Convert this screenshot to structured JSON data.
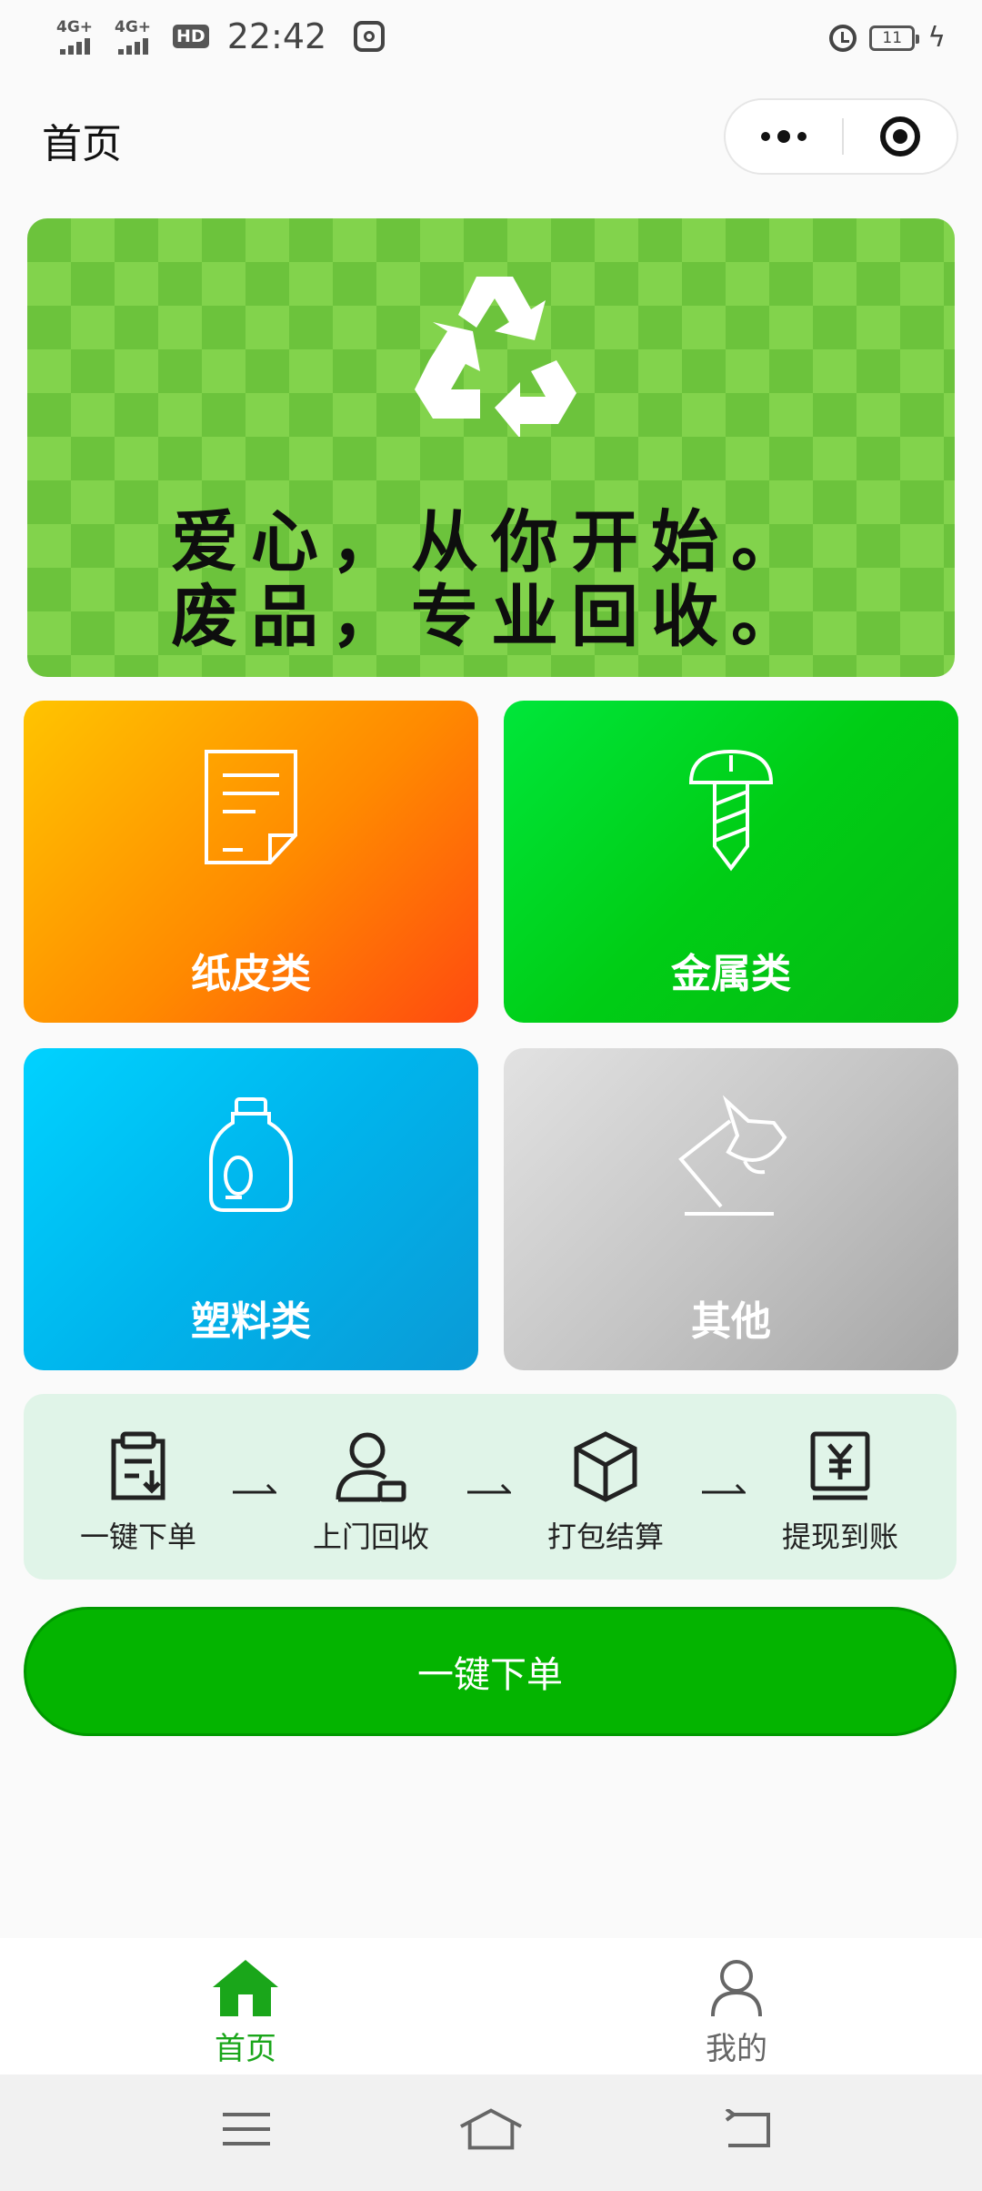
{
  "status_bar": {
    "network_1": "4G+",
    "network_2": "4G+",
    "hd_label": "HD",
    "time": "22:42",
    "battery_level": "11"
  },
  "header": {
    "title": "首页"
  },
  "banner": {
    "line1": "爱心，从你开始。",
    "line2": "废品，专业回收。",
    "icon": "recycle-icon"
  },
  "categories": [
    {
      "label": "纸皮类",
      "icon": "paper-document-icon",
      "colors": [
        "#ffc400",
        "#ff4a10"
      ]
    },
    {
      "label": "金属类",
      "icon": "screw-icon",
      "colors": [
        "#00e63a",
        "#06b913"
      ]
    },
    {
      "label": "塑料类",
      "icon": "plastic-bottle-icon",
      "colors": [
        "#00d2ff",
        "#0a9ad6"
      ]
    },
    {
      "label": "其他",
      "icon": "desk-lamp-icon",
      "colors": [
        "#e2e2e2",
        "#a6a6a6"
      ]
    }
  ],
  "process_steps": [
    {
      "label": "一键下单",
      "icon": "clipboard-order-icon"
    },
    {
      "label": "上门回收",
      "icon": "courier-person-icon"
    },
    {
      "label": "打包结算",
      "icon": "package-box-icon"
    },
    {
      "label": "提现到账",
      "icon": "yen-bill-icon"
    }
  ],
  "primary_button": {
    "label": "一键下单"
  },
  "tab_bar": {
    "home": "首页",
    "mine": "我的"
  },
  "theme": {
    "accent": "#04b400",
    "steps_background": "#e0f4e8"
  }
}
